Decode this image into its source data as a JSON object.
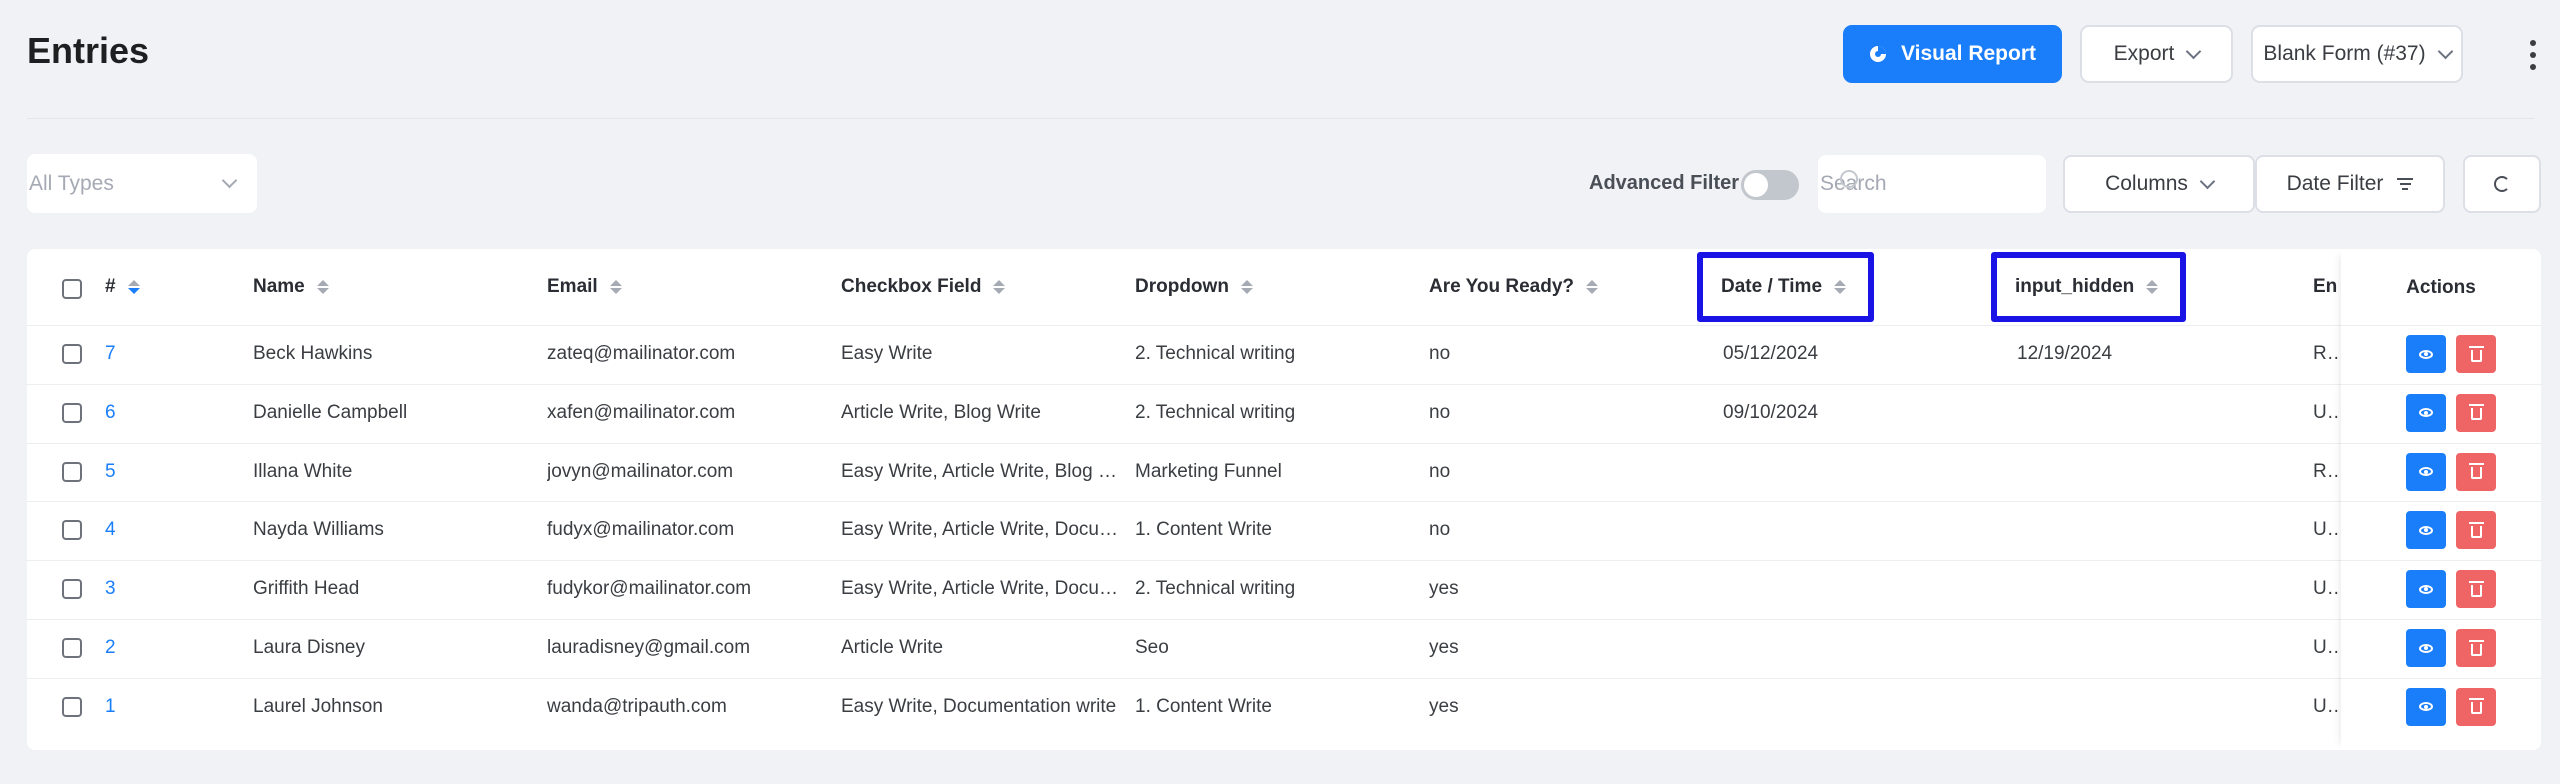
{
  "header": {
    "title": "Entries",
    "visual_report_label": "Visual Report",
    "export_label": "Export",
    "form_select_label": "Blank Form (#37)"
  },
  "filters": {
    "types_placeholder": "All Types",
    "advanced_filter_label": "Advanced Filter",
    "search_placeholder": "Search",
    "columns_label": "Columns",
    "date_filter_label": "Date Filter"
  },
  "table": {
    "headers": {
      "id": "#",
      "name": "Name",
      "email": "Email",
      "checkbox": "Checkbox Field",
      "dropdown": "Dropdown",
      "ready": "Are You Ready?",
      "datetime": "Date / Time",
      "hidden": "input_hidden",
      "entry_status": "Entry Status",
      "actions": "Actions"
    },
    "rows": [
      {
        "id": "7",
        "name": "Beck Hawkins",
        "email": "zateq@mailinator.com",
        "checkbox": "Easy Write",
        "dropdown": "2. Technical writing",
        "ready": "no",
        "datetime": "05/12/2024",
        "hidden": "12/19/2024",
        "status": "Read"
      },
      {
        "id": "6",
        "name": "Danielle Campbell",
        "email": "xafen@mailinator.com",
        "checkbox": "Article Write, Blog Write",
        "dropdown": "2. Technical writing",
        "ready": "no",
        "datetime": "09/10/2024",
        "hidden": "",
        "status": "Unread"
      },
      {
        "id": "5",
        "name": "Illana White",
        "email": "jovyn@mailinator.com",
        "checkbox": "Easy Write, Article Write, Blog Write",
        "dropdown": "Marketing Funnel",
        "ready": "no",
        "datetime": "",
        "hidden": "",
        "status": "Read"
      },
      {
        "id": "4",
        "name": "Nayda Williams",
        "email": "fudyx@mailinator.com",
        "checkbox": "Easy Write, Article Write, Documentation write",
        "dropdown": "1. Content Write",
        "ready": "no",
        "datetime": "",
        "hidden": "",
        "status": "Unread"
      },
      {
        "id": "3",
        "name": "Griffith Head",
        "email": "fudykor@mailinator.com",
        "checkbox": "Easy Write, Article Write, Documentation write",
        "dropdown": "2. Technical writing",
        "ready": "yes",
        "datetime": "",
        "hidden": "",
        "status": "Unread"
      },
      {
        "id": "2",
        "name": "Laura Disney",
        "email": "lauradisney@gmail.com",
        "checkbox": "Article Write",
        "dropdown": "Seo",
        "ready": "yes",
        "datetime": "",
        "hidden": "",
        "status": "Unread"
      },
      {
        "id": "1",
        "name": "Laurel Johnson",
        "email": "wanda@tripauth.com",
        "checkbox": "Easy Write, Documentation write",
        "dropdown": "1. Content Write",
        "ready": "yes",
        "datetime": "",
        "hidden": "",
        "status": "Unread"
      }
    ]
  },
  "colors": {
    "primary": "#1a7efb",
    "danger": "#ef6464",
    "highlight_border": "#1a13e6"
  }
}
